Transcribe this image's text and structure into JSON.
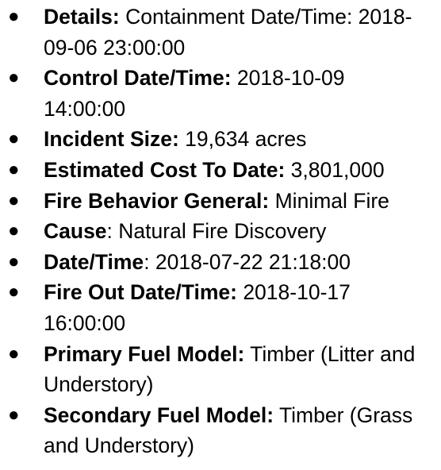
{
  "bullet_glyph": "●",
  "items": [
    {
      "key": "Details:",
      "sep": "",
      "value": " Containment Date/Time: 2018-09-06 23:00:00"
    },
    {
      "key": "Control Date/Time:",
      "sep": "",
      "value": " 2018-10-09 14:00:00"
    },
    {
      "key": "Incident Size:",
      "sep": "",
      "value": " 19,634 acres"
    },
    {
      "key": "Estimated Cost To Date:",
      "sep": "",
      "value": " 3,801,000"
    },
    {
      "key": "Fire Behavior General:",
      "sep": "",
      "value": " Minimal Fire"
    },
    {
      "key": "Cause",
      "sep": ":",
      "value": " Natural Fire Discovery"
    },
    {
      "key": "Date/Time",
      "sep": ":",
      "value": " 2018-07-22 21:18:00"
    },
    {
      "key": "Fire Out Date/Time:",
      "sep": "",
      "value": " 2018-10-17 16:00:00"
    },
    {
      "key": "Primary Fuel Model:",
      "sep": "",
      "value": " Timber (Litter and Understory)"
    },
    {
      "key": "Secondary Fuel Model:",
      "sep": "",
      "value": " Timber (Grass and Understory)"
    }
  ]
}
